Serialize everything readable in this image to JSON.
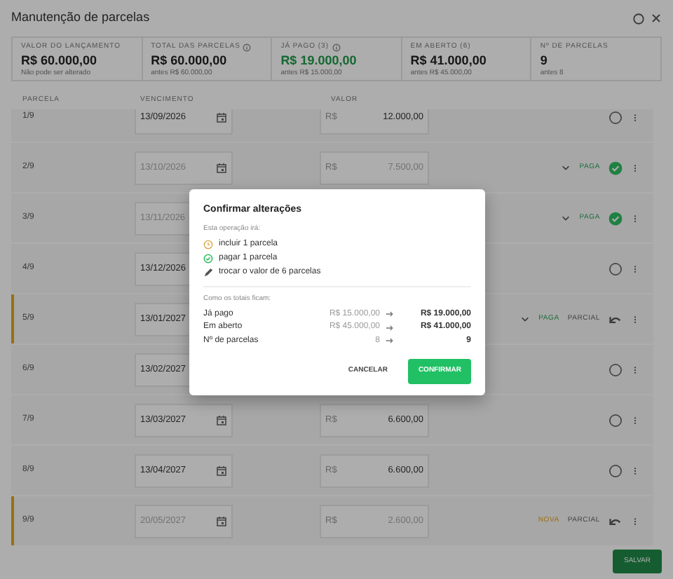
{
  "window": {
    "title": "Manutenção de parcelas"
  },
  "summary": [
    {
      "label": "VALOR DO LANÇAMENTO",
      "value": "R$ 60.000,00",
      "note": "Não pode ser alterado",
      "info": false,
      "positive": false
    },
    {
      "label": "TOTAL DAS PARCELAS",
      "value": "R$ 60.000,00",
      "note": "antes R$ 60.000,00",
      "info": true,
      "positive": false
    },
    {
      "label": "JÁ PAGO (3)",
      "value": "R$ 19.000,00",
      "note": "antes R$ 15.000,00",
      "info": true,
      "positive": true
    },
    {
      "label": "EM ABERTO (6)",
      "value": "R$ 41.000,00",
      "note": "antes R$ 45.000,00",
      "info": false,
      "positive": false
    },
    {
      "label": "Nº DE PARCELAS",
      "value": "9",
      "note": "antes 8",
      "info": false,
      "positive": false
    }
  ],
  "table": {
    "columns": [
      "PARCELA",
      "VENCIMENTO",
      "VALOR"
    ],
    "rows": [
      {
        "number": "1/9",
        "date": "13/09/2026",
        "currency": "R$",
        "value": "12.000,00",
        "locked": false,
        "highlight": false,
        "expandable": false,
        "badges": [],
        "kind": "open"
      },
      {
        "number": "2/9",
        "date": "13/10/2026",
        "currency": "R$",
        "value": "7.500,00",
        "locked": true,
        "highlight": false,
        "expandable": true,
        "badges": [
          {
            "kind": "paid",
            "text": "PAGA"
          }
        ],
        "kind": "paid"
      },
      {
        "number": "3/9",
        "date": "13/11/2026",
        "locked": true,
        "highlight": false,
        "expandable": true,
        "badges": [
          {
            "kind": "paid",
            "text": "PAGA"
          }
        ],
        "kind": "paid"
      },
      {
        "number": "4/9",
        "date": "13/12/2026",
        "locked": false,
        "highlight": false,
        "expandable": false,
        "badges": [],
        "kind": "open"
      },
      {
        "number": "5/9",
        "date": "13/01/2027",
        "locked": false,
        "highlight": true,
        "expandable": true,
        "badges": [
          {
            "kind": "paid",
            "text": "PAGA"
          },
          {
            "kind": "partial",
            "text": "PARCIAL"
          }
        ],
        "kind": "changed"
      },
      {
        "number": "6/9",
        "date": "13/02/2027",
        "locked": false,
        "highlight": false,
        "expandable": false,
        "badges": [],
        "kind": "open"
      },
      {
        "number": "7/9",
        "date": "13/03/2027",
        "currency": "R$",
        "value": "6.600,00",
        "locked": false,
        "highlight": false,
        "expandable": false,
        "badges": [],
        "kind": "open"
      },
      {
        "number": "8/9",
        "date": "13/04/2027",
        "currency": "R$",
        "value": "6.600,00",
        "locked": false,
        "highlight": false,
        "expandable": false,
        "badges": [],
        "kind": "open"
      },
      {
        "number": "9/9",
        "date": "20/05/2027",
        "currency": "R$",
        "value": "2.600,00",
        "locked": true,
        "highlight": true,
        "expandable": false,
        "badges": [
          {
            "kind": "new",
            "text": "NOVA"
          },
          {
            "kind": "partial",
            "text": "PARCIAL"
          }
        ],
        "kind": "changed"
      }
    ]
  },
  "footer": {
    "save_button": "SALVAR"
  },
  "dialog": {
    "title": "Confirmar alterações",
    "intro": "Esta operação irá:",
    "changes": [
      {
        "kind": "pending",
        "text": "incluir 1 parcela"
      },
      {
        "kind": "paid",
        "text": "pagar 1 parcela"
      },
      {
        "kind": "edit",
        "text": "trocar o valor de 6 parcelas"
      }
    ],
    "totals_title": "Como os totais ficam:",
    "totals": [
      {
        "label": "Já pago",
        "before": "R$ 15.000,00",
        "after": "R$ 19.000,00"
      },
      {
        "label": "Em aberto",
        "before": "R$ 45.000,00",
        "after": "R$ 41.000,00"
      },
      {
        "label": "Nº de parcelas",
        "before": "8",
        "after": "9"
      }
    ],
    "buttons": [
      {
        "kind": "secondary",
        "text": "CANCELAR"
      },
      {
        "kind": "primary",
        "text": "CONFIRMAR"
      }
    ]
  }
}
